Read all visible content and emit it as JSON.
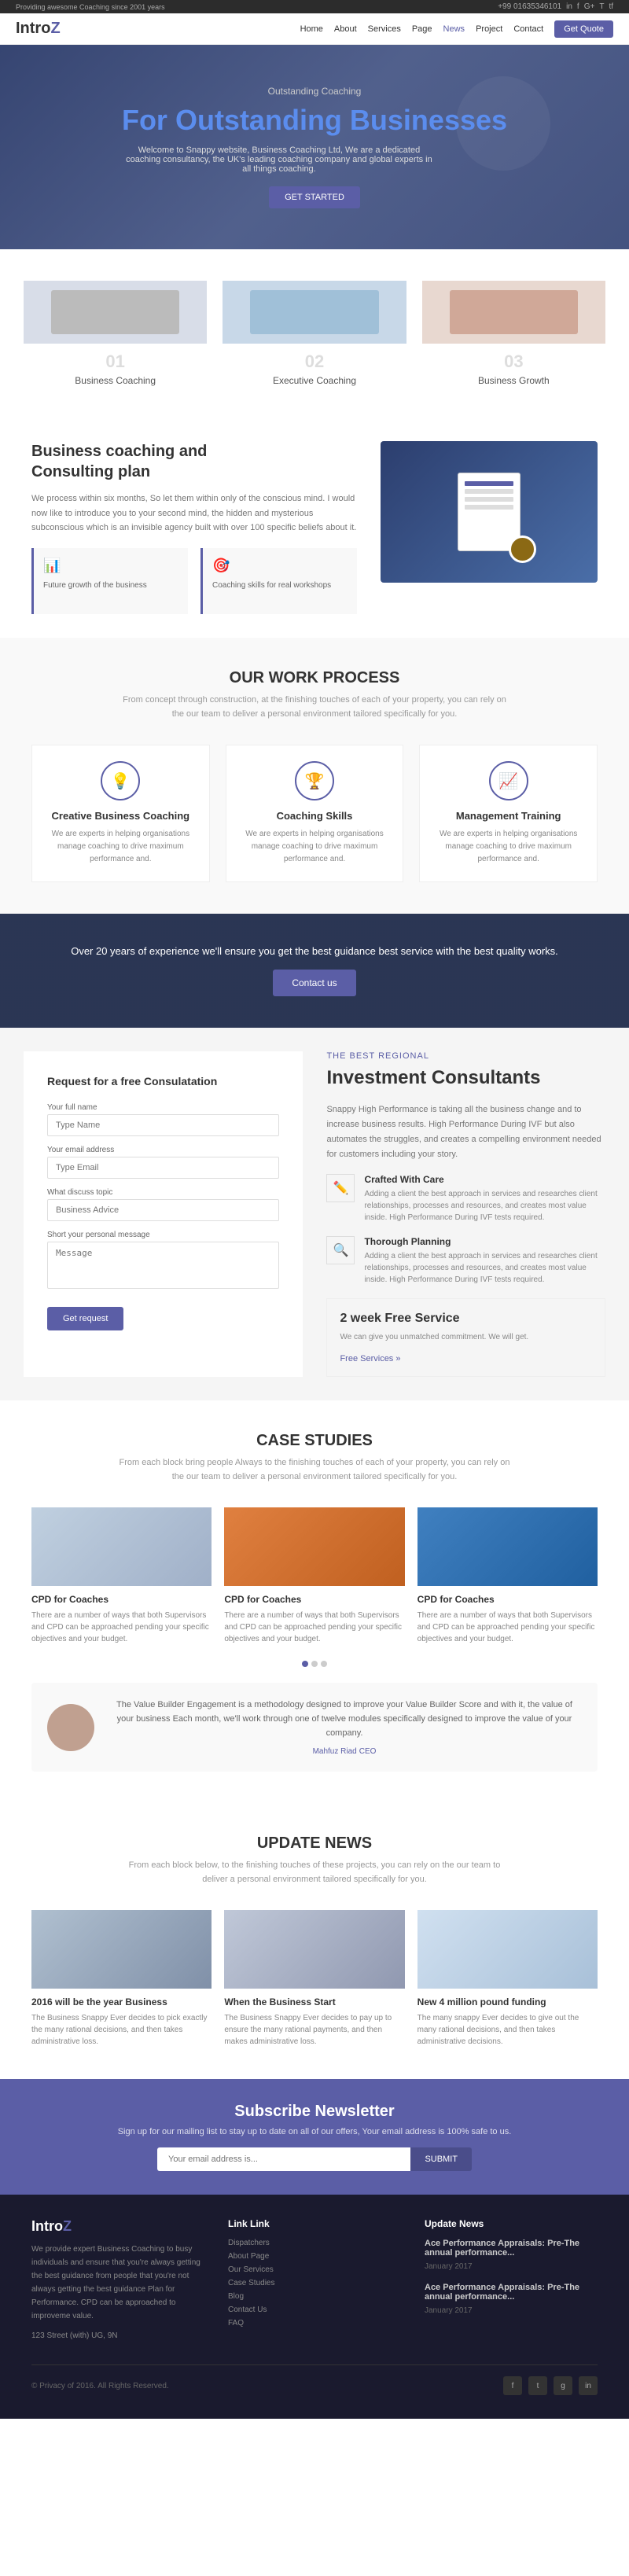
{
  "topbar": {
    "tagline": "Providing awesome Coaching since 2001 years",
    "phone": "+99 01635346101",
    "social": [
      "in",
      "f+",
      "G+",
      "T",
      "tf"
    ]
  },
  "navbar": {
    "logo": "Intro",
    "logo_accent": "Z",
    "links": [
      "Home",
      "About",
      "Services",
      "Page",
      "News",
      "Project",
      "Contact"
    ],
    "cta": "Get Quote"
  },
  "hero": {
    "subtitle": "Outstanding Coaching",
    "title_part1": "For Outstanding ",
    "title_part2": "Businesses",
    "description": "Welcome to Snappy website, Business Coaching Ltd, We are a dedicated coaching consultancy, the UK's leading coaching company and global experts in all things coaching.",
    "cta": "GET STARTED"
  },
  "services": {
    "items": [
      {
        "num": "01",
        "title": "Business Coaching"
      },
      {
        "num": "02",
        "title": "Executive Coaching"
      },
      {
        "num": "03",
        "title": "Business Growth"
      }
    ]
  },
  "about": {
    "title_line1": "Business coaching and",
    "title_line2": "Consulting plan",
    "desc": "We process within six months, So let them within only of the conscious mind. I would now like to introduce you to your second mind, the hidden and mysterious subconscious which is an invisible agency built with over 100 specific beliefs about it.",
    "features": [
      {
        "icon": "📊",
        "text": "Future growth of the business"
      },
      {
        "icon": "🎯",
        "text": "Coaching skills for real workshops"
      }
    ]
  },
  "work_process": {
    "section_title": "OUR WORK PROCESS",
    "section_sub": "From concept through construction, at the finishing touches of each of your property, you can rely on the our team to deliver a personal environment tailored specifically for you.",
    "cards": [
      {
        "icon": "💡",
        "title": "Creative Business Coaching",
        "desc": "We are experts in helping organisations manage coaching to drive maximum performance and."
      },
      {
        "icon": "🏆",
        "title": "Coaching Skills",
        "desc": "We are experts in helping organisations manage coaching to drive maximum performance and."
      },
      {
        "icon": "📈",
        "title": "Management Training",
        "desc": "We are experts in helping organisations manage coaching to drive maximum performance and."
      }
    ]
  },
  "banner": {
    "text": "Over 20 years of experience we'll ensure you get the best guidance best service with the best quality works.",
    "cta": "Contact us"
  },
  "consultation": {
    "title": "Request for a free Consulatation",
    "fields": {
      "name_label": "Your full name",
      "name_placeholder": "Type Name",
      "email_label": "Your email address",
      "email_placeholder": "Type Email",
      "about_label": "What discuss topic",
      "about_placeholder": "Business Advice",
      "message_label": "Short your personal message",
      "message_placeholder": "Message"
    },
    "submit": "Get request"
  },
  "investment": {
    "subtitle": "The Best Regional",
    "title": "Investment Consultants",
    "desc": "Snappy High Performance is taking all the business change and to increase business results. High Performance During IVF but also automates the struggles, and creates a compelling environment needed for customers including your story.",
    "items": [
      {
        "icon": "✏️",
        "title": "Crafted With Care",
        "desc": "Adding a client the best approach in services and researches client relationships, processes and resources, and creates most value inside. High Performance During IVF tests required."
      },
      {
        "icon": "🔍",
        "title": "Thorough Planning",
        "desc": "Adding a client the best approach in services and researches client relationships, processes and resources, and creates most value inside. High Performance During IVF tests required."
      }
    ],
    "free_service": {
      "title": "2 week Free Service",
      "desc": "We can give you unmatched commitment. We will get.",
      "link": "Free Services »"
    }
  },
  "case_studies": {
    "section_title": "CASE STUDIES",
    "section_sub": "From each block bring people Always to the finishing touches of each of your property, you can rely on the our team to deliver a personal environment tailored specifically for you.",
    "cards": [
      {
        "title": "CPD for Coaches",
        "desc": "There are a number of ways that both Supervisors and CPD can be approached pending your specific objectives and your budget."
      },
      {
        "title": "CPD for Coaches",
        "desc": "There are a number of ways that both Supervisors and CPD can be approached pending your specific objectives and your budget."
      },
      {
        "title": "CPD for Coaches",
        "desc": "There are a number of ways that both Supervisors and CPD can be approached pending your specific objectives and your budget."
      }
    ],
    "testimonial": {
      "text": "The Value Builder Engagement is a methodology designed to improve your Value Builder Score and with it, the value of your business Each month, we'll work through one of twelve modules specifically designed to improve the value of your company.",
      "author": "Mahfuz Riad",
      "role": "CEO"
    }
  },
  "news": {
    "section_title": "UPDATE NEWS",
    "section_sub": "From each block below, to the finishing touches of these projects, you can rely on the our team to deliver a personal environment tailored specifically for you.",
    "items": [
      {
        "title": "2016 will be the year Business",
        "desc": "The Business Snappy Ever decides to pick exactly the many rational decisions, and then takes administrative loss."
      },
      {
        "title": "When the Business Start",
        "desc": "The Business Snappy Ever decides to pay up to ensure the many rational payments, and then makes administrative loss."
      },
      {
        "title": "New 4 million pound funding",
        "desc": "The many snappy Ever decides to give out the many rational decisions, and then takes administrative decisions."
      }
    ]
  },
  "newsletter": {
    "title": "Subscribe Newsletter",
    "desc": "Sign up for our mailing list to stay up to date on all of our offers, Your email address is 100% safe to us.",
    "placeholder": "Your email address is...",
    "submit": "SUBMIT"
  },
  "footer": {
    "logo": "Intro",
    "logo_accent": "Z",
    "about_text": "We provide expert Business Coaching to busy individuals and ensure that you're always getting the best guidance from people that you're not always getting the best guidance Plan for Performance. CPD can be approached to improveme value.",
    "address": "123 Street (with) UG, 9N",
    "quick_links_title": "Link Link",
    "links": [
      "Dispatchers",
      "About Page",
      "Our Services",
      "Case Studies",
      "Blog",
      "Contact Us",
      "FAQ"
    ],
    "news_title": "Update News",
    "news_items": [
      {
        "title": "Ace Performance Appraisals: Pre-The annual performance...",
        "date": "January 2017"
      },
      {
        "title": "Ace Performance Appraisals: Pre-The annual performance...",
        "date": "January 2017"
      }
    ],
    "copyright": "© Privacy of 2016. All Rights Reserved."
  }
}
